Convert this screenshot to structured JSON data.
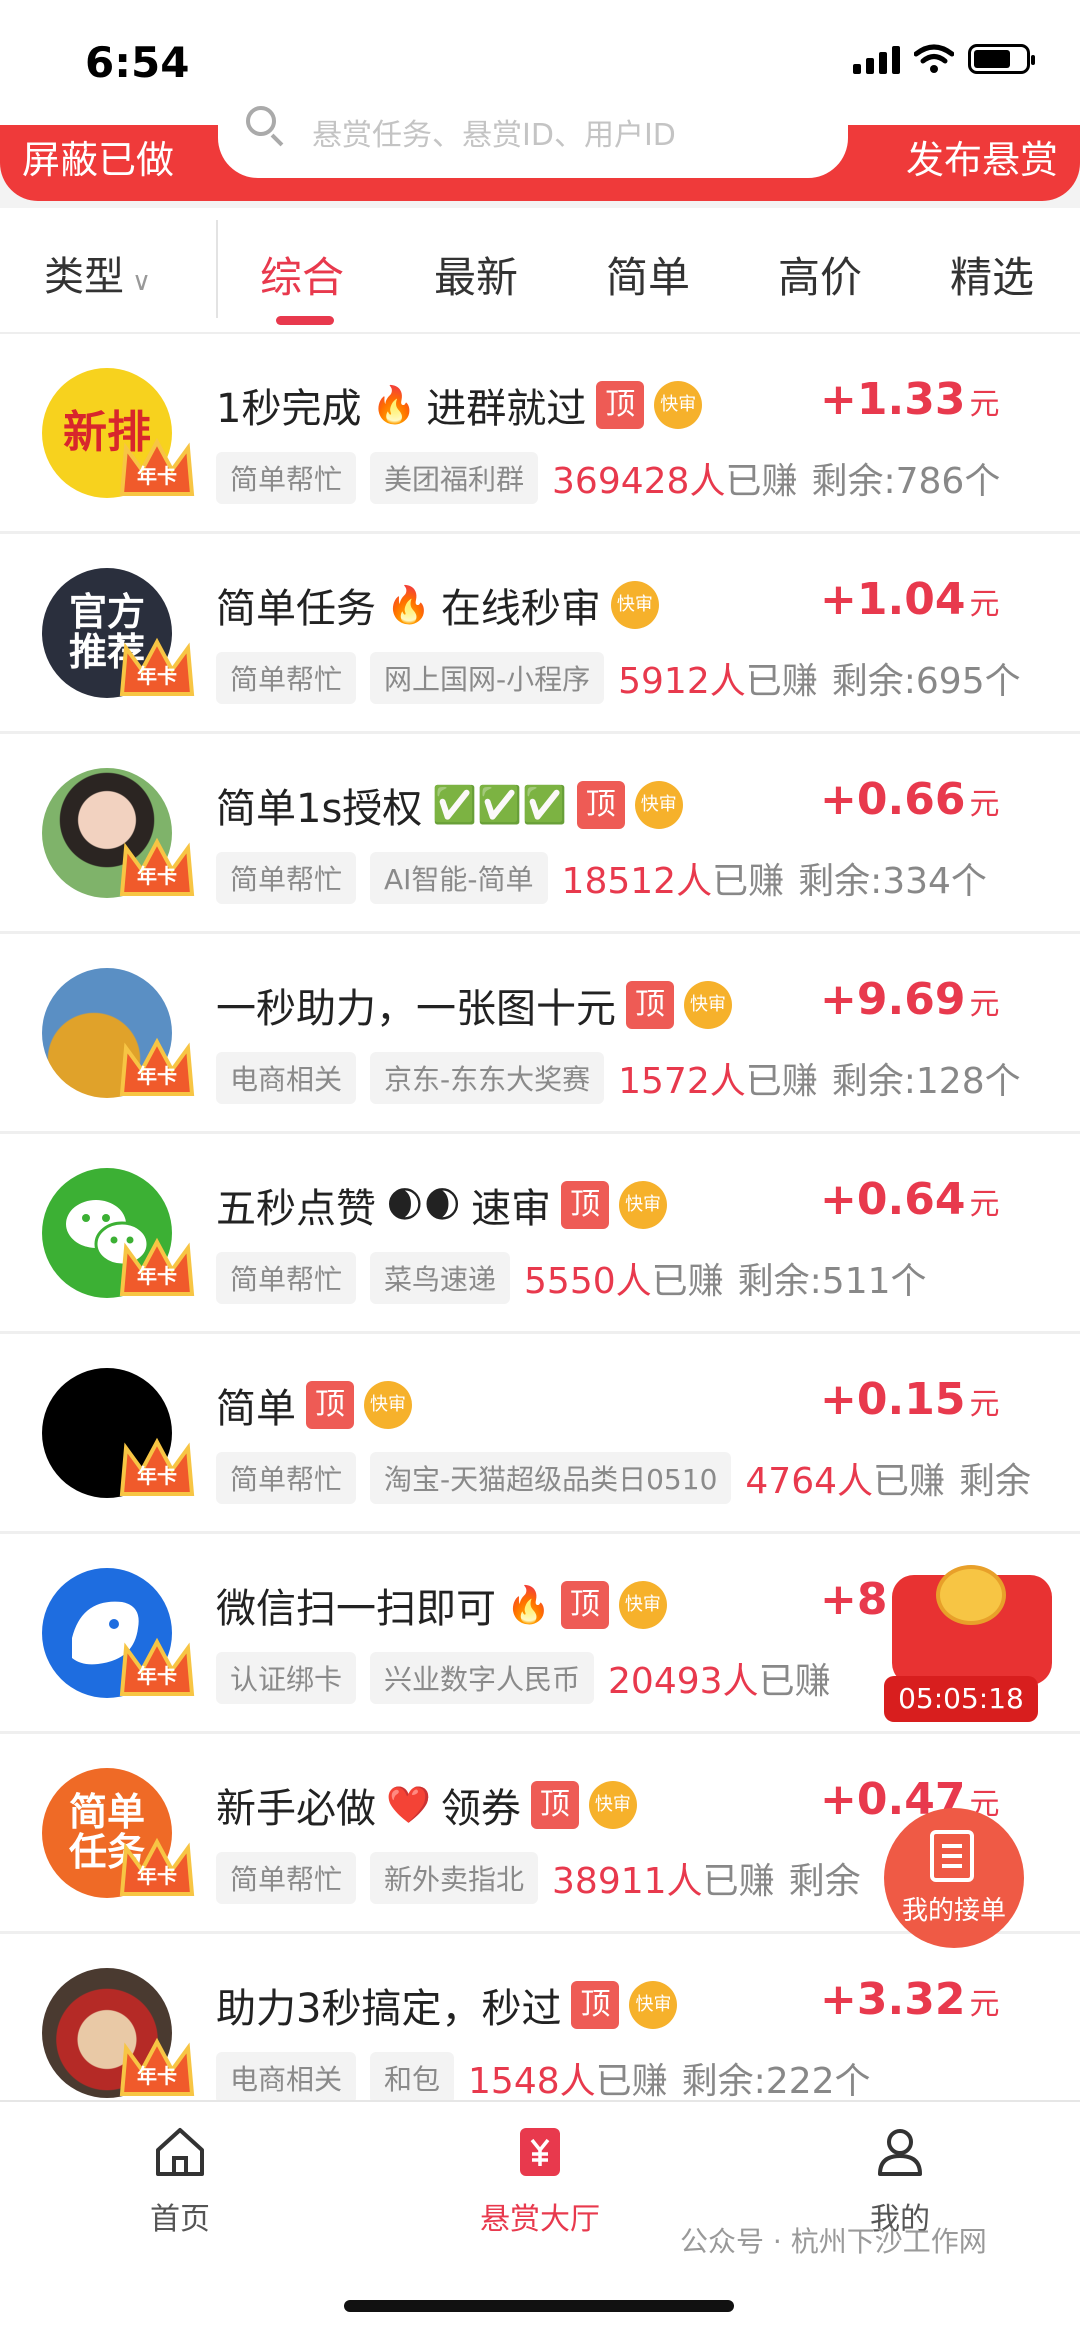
{
  "status": {
    "time": "6:54"
  },
  "header": {
    "left_label": "屏蔽已做",
    "right_label": "发布悬赏",
    "search_placeholder": "悬赏任务、悬赏ID、用户ID"
  },
  "filter": {
    "type_label": "类型",
    "tabs": [
      "综合",
      "最新",
      "简单",
      "高价",
      "精选"
    ],
    "active_tab": "综合"
  },
  "tasks": [
    {
      "avatar_text": "新排",
      "title": "1秒完成",
      "emoji1": "🔥",
      "title2": "进群就过",
      "top": "顶",
      "fast": "快审",
      "reward": "+1.33",
      "unit": "元",
      "tag1": "简单帮忙",
      "tag2": "美团福利群",
      "earned_count": "369428人",
      "earned_suffix": "已赚",
      "remaining": "剩余:786个",
      "crown": "年卡"
    },
    {
      "avatar_text": "官方推荐",
      "title": "简单任务",
      "emoji1": "🔥",
      "title2": "在线秒审",
      "top": "",
      "fast": "快审",
      "reward": "+1.04",
      "unit": "元",
      "tag1": "简单帮忙",
      "tag2": "网上国网-小程序",
      "earned_count": "5912人",
      "earned_suffix": "已赚",
      "remaining": "剩余:695个",
      "crown": "年卡"
    },
    {
      "avatar_text": "",
      "title": "简单1s授权",
      "emoji1": "✅✅✅",
      "title2": "",
      "top": "顶",
      "fast": "快审",
      "reward": "+0.66",
      "unit": "元",
      "tag1": "简单帮忙",
      "tag2": "AI智能-简单",
      "earned_count": "18512人",
      "earned_suffix": "已赚",
      "remaining": "剩余:334个",
      "crown": "年卡"
    },
    {
      "avatar_text": "",
      "title": "一秒助力，一张图十元",
      "emoji1": "",
      "title2": "",
      "top": "顶",
      "fast": "快审",
      "reward": "+9.69",
      "unit": "元",
      "tag1": "电商相关",
      "tag2": "京东-东东大奖赛",
      "earned_count": "1572人",
      "earned_suffix": "已赚",
      "remaining": "剩余:128个",
      "crown": "年卡"
    },
    {
      "avatar_text": "",
      "title": "五秒点赞",
      "emoji1": "🌒🌒",
      "title2": "速审",
      "top": "顶",
      "fast": "快审",
      "reward": "+0.64",
      "unit": "元",
      "tag1": "简单帮忙",
      "tag2": "菜鸟速递",
      "earned_count": "5550人",
      "earned_suffix": "已赚",
      "remaining": "剩余:511个",
      "crown": "年卡"
    },
    {
      "avatar_text": "",
      "title": "简单",
      "emoji1": "",
      "title2": "",
      "top": "顶",
      "fast": "快审",
      "reward": "+0.15",
      "unit": "元",
      "tag1": "简单帮忙",
      "tag2": "淘宝-天猫超级品类日0510",
      "earned_count": "4764人",
      "earned_suffix": "已赚",
      "remaining": "剩余",
      "crown": "年卡"
    },
    {
      "avatar_text": "",
      "title": "微信扫一扫即可",
      "emoji1": "🔥",
      "title2": "",
      "top": "顶",
      "fast": "快审",
      "reward": "+8.5",
      "unit": "",
      "tag1": "认证绑卡",
      "tag2": "兴业数字人民币",
      "earned_count": "20493人",
      "earned_suffix": "已赚",
      "remaining": "",
      "crown": "年卡"
    },
    {
      "avatar_text": "简单任务",
      "title": "新手必做",
      "emoji1": "❤️",
      "title2": "领券",
      "top": "顶",
      "fast": "快审",
      "reward": "+0.47",
      "unit": "元",
      "tag1": "简单帮忙",
      "tag2": "新外卖指北",
      "earned_count": "38911人",
      "earned_suffix": "已赚",
      "remaining": "剩余",
      "crown": "年卡"
    },
    {
      "avatar_text": "",
      "title": "助力3秒搞定，秒过",
      "emoji1": "",
      "title2": "",
      "top": "顶",
      "fast": "快审",
      "reward": "+3.32",
      "unit": "元",
      "tag1": "电商相关",
      "tag2": "和包",
      "earned_count": "1548人",
      "earned_suffix": "已赚",
      "remaining": "剩余:222个",
      "crown": "年卡"
    }
  ],
  "floating": {
    "countdown": "05:05:18",
    "my_orders": "我的接单"
  },
  "nav": {
    "home": "首页",
    "hall": "悬赏大厅",
    "mine": "我的"
  },
  "watermark": "公众号 · 杭州下沙工作网",
  "colors": {
    "brand_red": "#ef3a3a",
    "accent": "#e8394d",
    "fast_badge": "#f6b12b"
  }
}
